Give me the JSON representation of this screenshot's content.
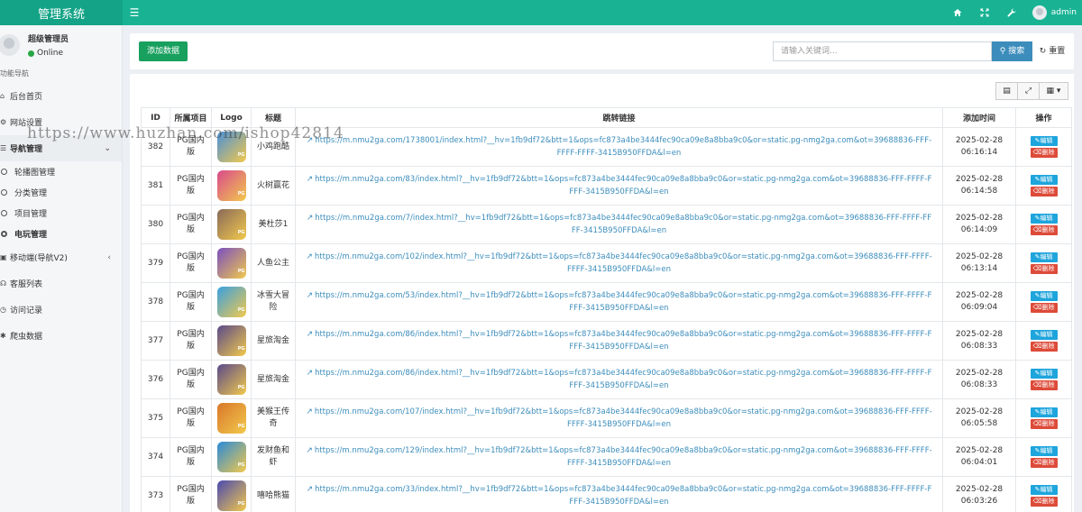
{
  "header": {
    "brand": "管理系统",
    "user": "admin"
  },
  "sidebar": {
    "user_name": "超级管理员",
    "status": "Online",
    "nav_header": "功能导航",
    "items": [
      {
        "label": "后台首页",
        "icon": "home-icon"
      },
      {
        "label": "网站设置",
        "icon": "gears-icon"
      },
      {
        "label": "导航管理",
        "icon": "bars-icon"
      },
      {
        "label": "移动端(导航V2)",
        "icon": "mobile-icon"
      },
      {
        "label": "客服列表",
        "icon": "support-icon"
      },
      {
        "label": "访问记录",
        "icon": "history-icon"
      },
      {
        "label": "爬虫数据",
        "icon": "spider-icon"
      }
    ],
    "sub_items": [
      {
        "label": "轮播图管理"
      },
      {
        "label": "分类管理"
      },
      {
        "label": "项目管理"
      },
      {
        "label": "电玩管理"
      }
    ]
  },
  "toolbar": {
    "add_label": "添加数据",
    "search_placeholder": "请输入关键词...",
    "search_label": "搜索",
    "reset_label": "重置"
  },
  "table": {
    "headers": [
      "ID",
      "所属项目",
      "Logo",
      "标题",
      "跳转链接",
      "添加时间",
      "操作"
    ],
    "edit_label": "编辑",
    "delete_label": "删除",
    "rows": [
      {
        "id": "382",
        "project": "PG国内版",
        "title": "小鸡跑酷",
        "link": "https://m.nmu2ga.com/1738001/index.html?__hv=1fb9df72&btt=1&ops=fc873a4be3444fec90ca09e8a8bba9c0&or=static.pg-nmg2ga.com&ot=39688836-FFF-FFFF-FFFF-3415B950FFDA&l=en",
        "date": "2025-02-28",
        "time": "06:16:14",
        "logo_color": "#4a90d9"
      },
      {
        "id": "381",
        "project": "PG国内版",
        "title": "火树赢花",
        "link": "https://m.nmu2ga.com/83/index.html?__hv=1fb9df72&btt=1&ops=fc873a4be3444fec90ca09e8a8bba9c0&or=static.pg-nmg2ga.com&ot=39688836-FFF-FFFF-FFFF-3415B950FFDA&l=en",
        "date": "2025-02-28",
        "time": "06:14:58",
        "logo_color": "#d94a8c"
      },
      {
        "id": "380",
        "project": "PG国内版",
        "title": "美杜莎1",
        "link": "https://m.nmu2ga.com/7/index.html?__hv=1fb9df72&btt=1&ops=fc873a4be3444fec90ca09e8a8bba9c0&or=static.pg-nmg2ga.com&ot=39688836-FFF-FFFF-FFFF-3415B950FFDA&l=en",
        "date": "2025-02-28",
        "time": "06:14:09",
        "logo_color": "#8a6a5a"
      },
      {
        "id": "379",
        "project": "PG国内版",
        "title": "人鱼公主",
        "link": "https://m.nmu2ga.com/102/index.html?__hv=1fb9df72&btt=1&ops=fc873a4be3444fec90ca09e8a8bba9c0&or=static.pg-nmg2ga.com&ot=39688836-FFF-FFFF-FFFF-3415B950FFDA&l=en",
        "date": "2025-02-28",
        "time": "06:13:14",
        "logo_color": "#7a4fc0"
      },
      {
        "id": "378",
        "project": "PG国内版",
        "title": "冰雪大冒险",
        "link": "https://m.nmu2ga.com/53/index.html?__hv=1fb9df72&btt=1&ops=fc873a4be3444fec90ca09e8a8bba9c0&or=static.pg-nmg2ga.com&ot=39688836-FFF-FFFF-FFFF-3415B950FFDA&l=en",
        "date": "2025-02-28",
        "time": "06:09:04",
        "logo_color": "#3aa0e0"
      },
      {
        "id": "377",
        "project": "PG国内版",
        "title": "星旅淘金",
        "link": "https://m.nmu2ga.com/86/index.html?__hv=1fb9df72&btt=1&ops=fc873a4be3444fec90ca09e8a8bba9c0&or=static.pg-nmg2ga.com&ot=39688836-FFF-FFFF-FFFF-3415B950FFDA&l=en",
        "date": "2025-02-28",
        "time": "06:08:33",
        "logo_color": "#5a4a8a"
      },
      {
        "id": "376",
        "project": "PG国内版",
        "title": "星旅淘金",
        "link": "https://m.nmu2ga.com/86/index.html?__hv=1fb9df72&btt=1&ops=fc873a4be3444fec90ca09e8a8bba9c0&or=static.pg-nmg2ga.com&ot=39688836-FFF-FFFF-FFFF-3415B950FFDA&l=en",
        "date": "2025-02-28",
        "time": "06:08:33",
        "logo_color": "#5a4a8a"
      },
      {
        "id": "375",
        "project": "PG国内版",
        "title": "美猴王传奇",
        "link": "https://m.nmu2ga.com/107/index.html?__hv=1fb9df72&btt=1&ops=fc873a4be3444fec90ca09e8a8bba9c0&or=static.pg-nmg2ga.com&ot=39688836-FFF-FFFF-FFFF-3415B950FFDA&l=en",
        "date": "2025-02-28",
        "time": "06:05:58",
        "logo_color": "#d9772a"
      },
      {
        "id": "374",
        "project": "PG国内版",
        "title": "发财鱼和虾",
        "link": "https://m.nmu2ga.com/129/index.html?__hv=1fb9df72&btt=1&ops=fc873a4be3444fec90ca09e8a8bba9c0&or=static.pg-nmg2ga.com&ot=39688836-FFF-FFFF-FFFF-3415B950FFDA&l=en",
        "date": "2025-02-28",
        "time": "06:04:01",
        "logo_color": "#2a8ad9"
      },
      {
        "id": "373",
        "project": "PG国内版",
        "title": "嘻哈熊猫",
        "link": "https://m.nmu2ga.com/33/index.html?__hv=1fb9df72&btt=1&ops=fc873a4be3444fec90ca09e8a8bba9c0&or=static.pg-nmg2ga.com&ot=39688836-FFF-FFFF-FFFF-3415B950FFDA&l=en",
        "date": "2025-02-28",
        "time": "06:03:26",
        "logo_color": "#4a4ab0"
      }
    ]
  },
  "watermark": "https://www.huzhan.com/ishop42814",
  "colors": {
    "topbar": "#19b394",
    "add_button": "#18a05e",
    "search_button": "#3c8dbc",
    "edit_button": "#1ea5dc",
    "delete_button": "#dd4b39",
    "link": "#3c8dbc"
  }
}
